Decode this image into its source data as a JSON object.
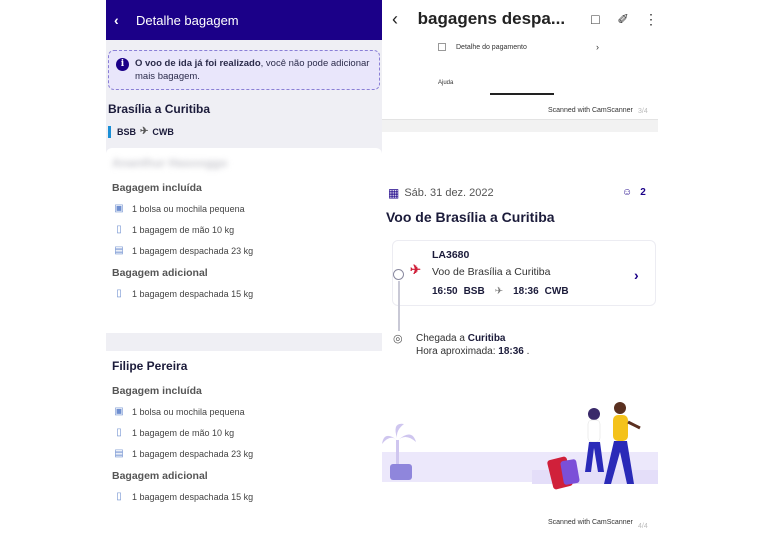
{
  "left": {
    "header": {
      "back_icon": "chevron-left-icon",
      "title": "Detalhe bagagem"
    },
    "notice": {
      "icon": "info-icon",
      "bold_text": "O voo de ida já foi realizado",
      "rest_text": ", você não pode adicionar mais bagagem."
    },
    "route": {
      "title": "Brasília a Curitiba",
      "origin": "BSB",
      "destination": "CWB"
    },
    "passengers": [
      {
        "name": "Ananthur Hasooggo",
        "name_blurred": true,
        "included_title": "Bagagem incluída",
        "included": [
          {
            "icon": "backpack-icon",
            "text": "1 bolsa ou mochila pequena"
          },
          {
            "icon": "carry-on-icon",
            "text": "1 bagagem de mão 10 kg"
          },
          {
            "icon": "checked-bag-icon",
            "text": "1 bagagem despachada 23 kg"
          }
        ],
        "extra_title": "Bagagem adicional",
        "extra": [
          {
            "icon": "suitcase-icon",
            "text": "1 bagagem despachada 15 kg"
          }
        ]
      },
      {
        "name": "Filipe Pereira",
        "name_blurred": false,
        "included_title": "Bagagem incluída",
        "included": [
          {
            "icon": "backpack-icon",
            "text": "1 bolsa ou mochila pequena"
          },
          {
            "icon": "carry-on-icon",
            "text": "1 bagagem de mão 10 kg"
          },
          {
            "icon": "checked-bag-icon",
            "text": "1 bagagem despachada 23 kg"
          }
        ],
        "extra_title": "Bagagem adicional",
        "extra": [
          {
            "icon": "suitcase-icon",
            "text": "1 bagagem despachada 15 kg"
          }
        ]
      }
    ]
  },
  "right": {
    "header": {
      "title": "bagagens despa...",
      "tools": [
        "book-icon",
        "paperclip-icon",
        "more-vertical-icon"
      ]
    },
    "doc_top": {
      "row_text": "Detalhe do pagamento",
      "ajuda": "Ajuda",
      "scanner": "Scanned with CamScanner",
      "page": "3/4"
    },
    "trip": {
      "date": "Sáb. 31 dez. 2022",
      "passenger_count": "2",
      "title": "Voo de Brasília a Curitiba",
      "flight_number": "LA3680",
      "flight_route": "Voo de Brasília a Curitiba",
      "dep_time": "16:50",
      "dep_code": "BSB",
      "arr_time": "18:36",
      "arr_code": "CWB",
      "arrival_label": "Chegada a ",
      "arrival_city": "Curitiba",
      "approx_label": "Hora aproximada: ",
      "approx_time": "18:36",
      "approx_suffix": " ."
    },
    "doc_bottom": {
      "scanner": "Scanned with CamScanner",
      "page": "4/4"
    }
  },
  "colors": {
    "brand": "#1b0088",
    "accent_red": "#d0203a",
    "notice_bg": "#e9e6fb"
  }
}
